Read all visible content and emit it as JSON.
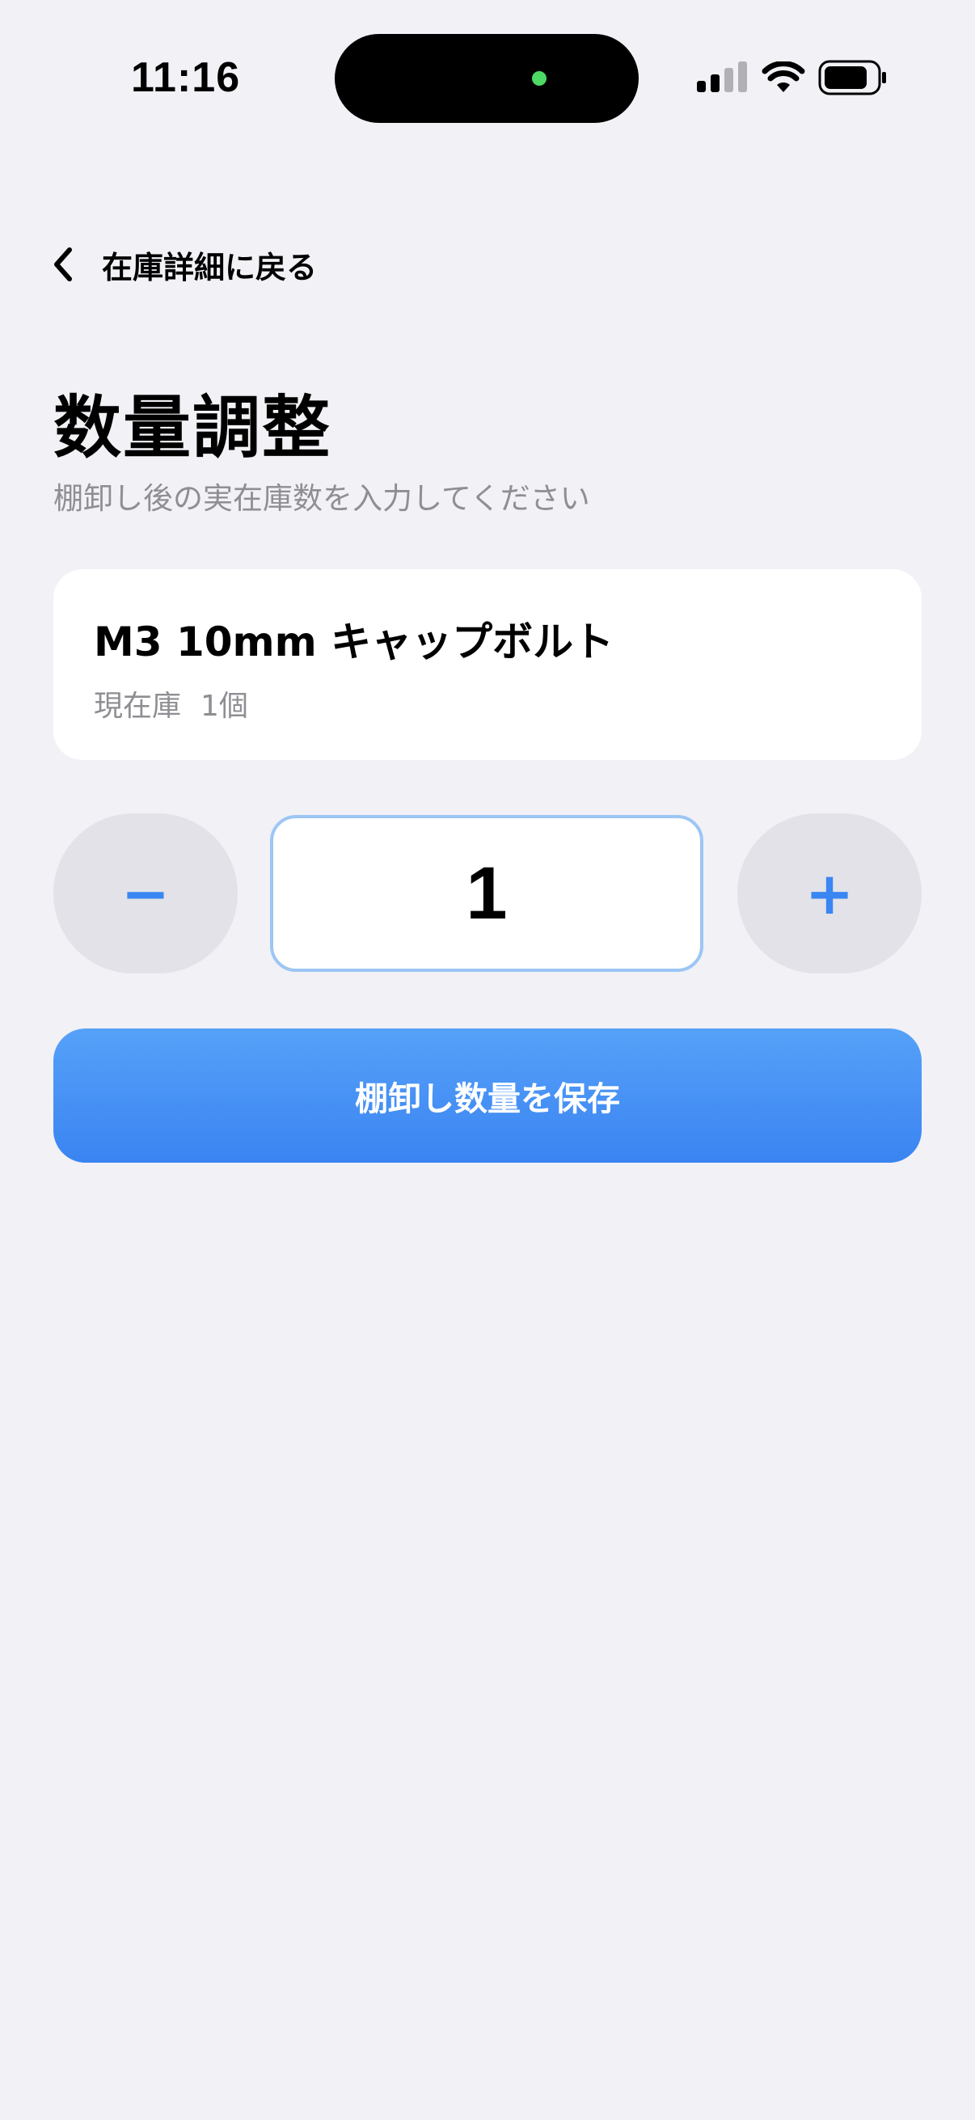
{
  "status_bar": {
    "time": "11:16"
  },
  "nav": {
    "back_label": "在庫詳細に戻る",
    "back_icon": "chevron-left-icon"
  },
  "header": {
    "title": "数量調整",
    "subtitle": "棚卸し後の実在庫数を入力してください"
  },
  "item": {
    "name": "M3 10mm キャップボルト",
    "stock_label": "現在庫",
    "stock_value": "1個"
  },
  "stepper": {
    "minus_label": "−",
    "plus_label": "+",
    "value": "1"
  },
  "actions": {
    "save_label": "棚卸し数量を保存"
  },
  "colors": {
    "background": "#f1f1f6",
    "accent": "#3a86f2",
    "secondary_text": "#8e8e93"
  }
}
